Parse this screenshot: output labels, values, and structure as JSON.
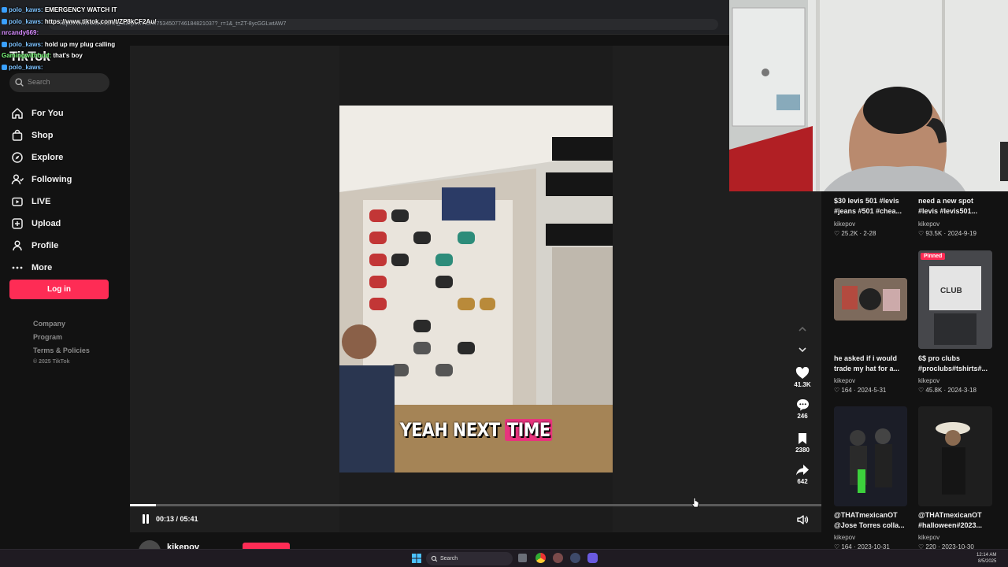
{
  "browser": {
    "url": "https://www.tiktok.com/@kikepov/video/7534507746184821037?_r=1&_t=ZT-8ycGGLwtAW7"
  },
  "chat": [
    {
      "user": "polo_kaws:",
      "message": "EMERGENCY WATCH IT",
      "color": "#7ec3ff"
    },
    {
      "user": "polo_kaws:",
      "message": "https://www.tiktok.com/t/ZP8kCF2Au/",
      "color": "#7ec3ff"
    },
    {
      "user": "nrcandy669:",
      "message": "",
      "color": "#d78bff"
    },
    {
      "user": "polo_kaws:",
      "message": "hold up my plug calling",
      "color": "#7ec3ff"
    },
    {
      "user": "Gamingwithbud:",
      "message": "that's boy",
      "color": "#7dff7d"
    },
    {
      "user": "polo_kaws:",
      "message": "",
      "color": "#7ec3ff"
    }
  ],
  "sidebar": {
    "logo": "TikTok",
    "search_placeholder": "Search",
    "items": [
      {
        "label": "For You",
        "icon": "home-icon"
      },
      {
        "label": "Shop",
        "icon": "shop-icon"
      },
      {
        "label": "Explore",
        "icon": "compass-icon"
      },
      {
        "label": "Following",
        "icon": "following-icon"
      },
      {
        "label": "LIVE",
        "icon": "live-icon"
      },
      {
        "label": "Upload",
        "icon": "upload-icon"
      },
      {
        "label": "Profile",
        "icon": "profile-icon"
      },
      {
        "label": "More",
        "icon": "more-icon"
      }
    ],
    "login_label": "Log in",
    "footer_links": [
      "Company",
      "Program",
      "Terms & Policies"
    ],
    "copyright": "© 2025 TikTok"
  },
  "player": {
    "caption_part1": "YEAH NEXT ",
    "caption_highlight": "TIME",
    "time_display": "00:13 / 05:41",
    "progress": 0.038,
    "author": "kikepov"
  },
  "actions": {
    "likes": "41.3K",
    "comments": "246",
    "saves": "2380",
    "shares": "642"
  },
  "grid": [
    {
      "title": "$30 levis 501 #levis #jeans #501 #chea...",
      "author": "kikepov",
      "likes": "25.2K",
      "date": "2-28"
    },
    {
      "title": "need a new spot #levis #levis501...",
      "author": "kikepov",
      "likes": "93.5K",
      "date": "2024-9-19"
    },
    {
      "title": "he asked if i would trade my hat for a...",
      "author": "kikepov",
      "likes": "164",
      "date": "2024-5-31"
    },
    {
      "title": "6$ pro clubs #proclubs#tshirts#...",
      "author": "kikepov",
      "likes": "45.8K",
      "date": "2024-3-18",
      "badge": "Pinned",
      "thumb_text": "CLUB"
    },
    {
      "title": "@THATmexicanOT @Jose Torres colla...",
      "author": "kikepov",
      "likes": "164",
      "date": "2023-10-31"
    },
    {
      "title": "@THATmexicanOT #halloween#2023...",
      "author": "kikepov",
      "likes": "220",
      "date": "2023-10-30"
    }
  ],
  "taskbar": {
    "search": "Search",
    "time": "12:14 AM",
    "date": "8/5/2025"
  },
  "colors": {
    "accent": "#fe2c55",
    "background": "#121212",
    "caption_highlight": "#e8347d"
  }
}
